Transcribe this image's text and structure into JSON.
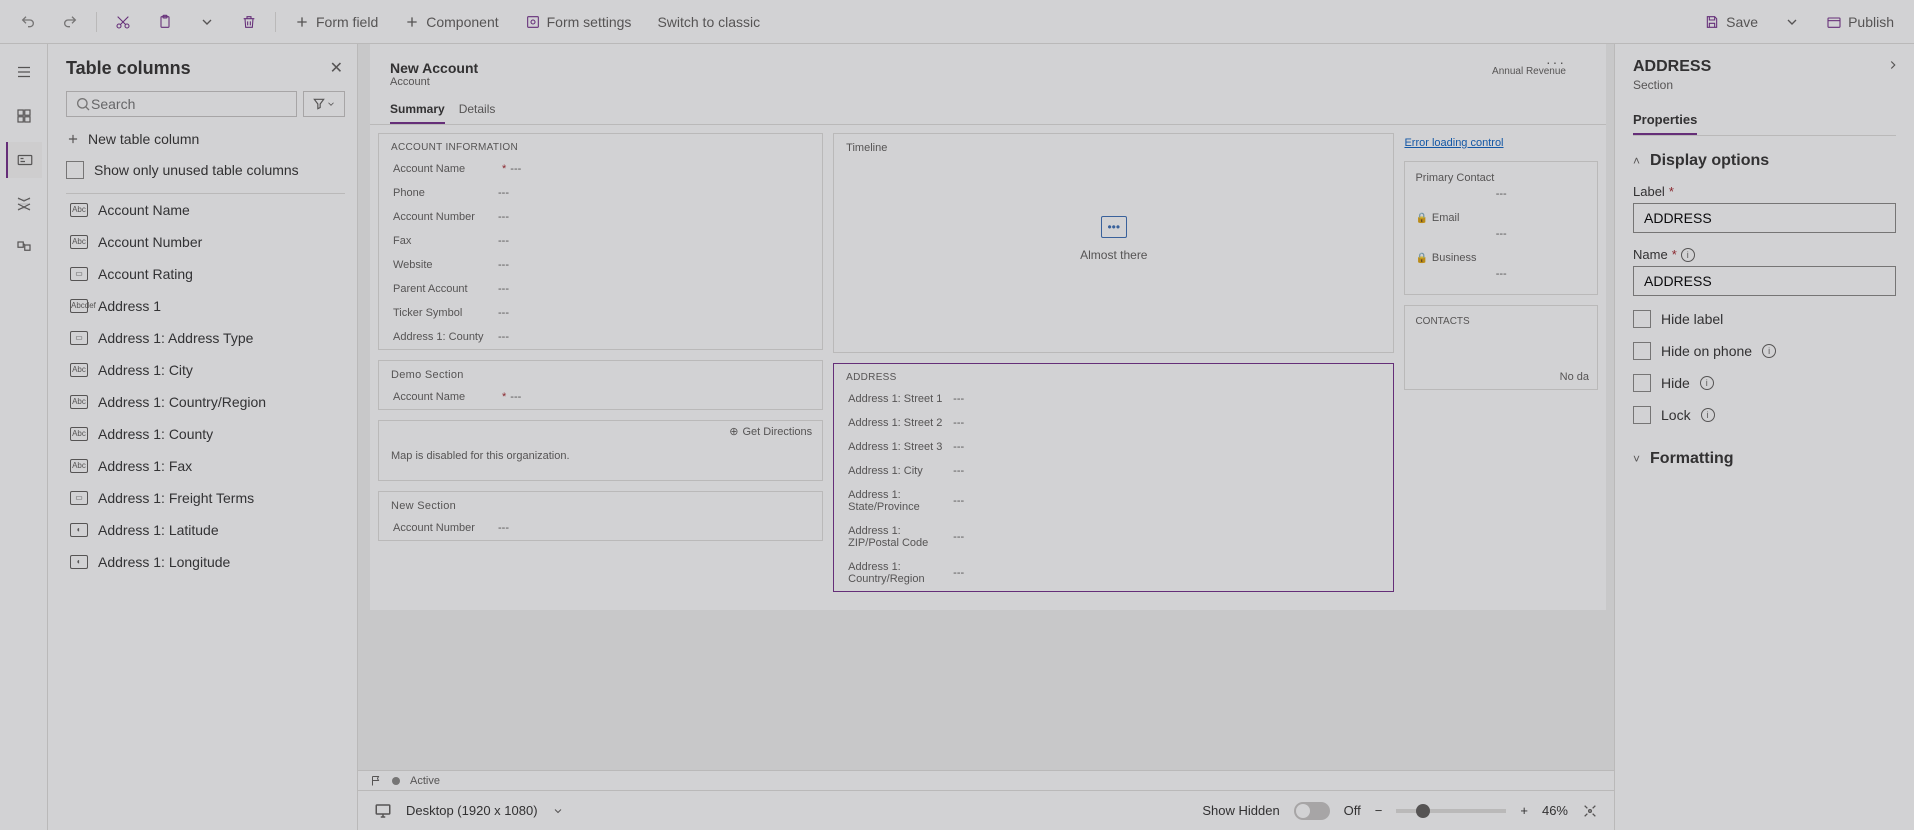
{
  "toolbar": {
    "form_field": "Form field",
    "component": "Component",
    "form_settings": "Form settings",
    "switch_classic": "Switch to classic",
    "save": "Save",
    "publish": "Publish"
  },
  "columns_panel": {
    "title": "Table columns",
    "search_placeholder": "Search",
    "new_column": "New table column",
    "show_unused": "Show only unused table columns",
    "items": [
      {
        "icon": "Abc",
        "label": "Account Name"
      },
      {
        "icon": "Abc",
        "label": "Account Number"
      },
      {
        "icon": "▭",
        "label": "Account Rating"
      },
      {
        "icon": "Abc\ndef",
        "label": "Address 1"
      },
      {
        "icon": "▭",
        "label": "Address 1: Address Type"
      },
      {
        "icon": "Abc",
        "label": "Address 1: City"
      },
      {
        "icon": "Abc",
        "label": "Address 1: Country/Region"
      },
      {
        "icon": "Abc",
        "label": "Address 1: County"
      },
      {
        "icon": "Abc",
        "label": "Address 1: Fax"
      },
      {
        "icon": "▭",
        "label": "Address 1: Freight Terms"
      },
      {
        "icon": "◐",
        "label": "Address 1: Latitude"
      },
      {
        "icon": "◐",
        "label": "Address 1: Longitude"
      }
    ]
  },
  "canvas": {
    "form_title": "New Account",
    "entity": "Account",
    "annual_rev": "Annual Revenue",
    "tabs": [
      "Summary",
      "Details"
    ],
    "active_tab": 0,
    "section_account_info": {
      "title": "ACCOUNT INFORMATION",
      "fields": [
        {
          "label": "Account Name",
          "required": true,
          "value": "---"
        },
        {
          "label": "Phone",
          "required": false,
          "value": "---"
        },
        {
          "label": "Account Number",
          "required": false,
          "value": "---"
        },
        {
          "label": "Fax",
          "required": false,
          "value": "---"
        },
        {
          "label": "Website",
          "required": false,
          "value": "---"
        },
        {
          "label": "Parent Account",
          "required": false,
          "value": "---"
        },
        {
          "label": "Ticker Symbol",
          "required": false,
          "value": "---"
        },
        {
          "label": "Address 1: County",
          "required": false,
          "value": "---"
        }
      ]
    },
    "section_demo": {
      "title": "Demo Section",
      "fields": [
        {
          "label": "Account Name",
          "required": true,
          "value": "---"
        }
      ]
    },
    "section_map": {
      "get_directions": "Get Directions",
      "message": "Map is disabled for this organization."
    },
    "section_new": {
      "title": "New Section",
      "fields": [
        {
          "label": "Account Number",
          "required": false,
          "value": "---"
        }
      ]
    },
    "section_timeline": {
      "title": "Timeline",
      "message": "Almost there"
    },
    "section_address": {
      "title": "ADDRESS",
      "fields": [
        {
          "label": "Address 1: Street 1",
          "value": "---"
        },
        {
          "label": "Address 1: Street 2",
          "value": "---"
        },
        {
          "label": "Address 1: Street 3",
          "value": "---"
        },
        {
          "label": "Address 1: City",
          "value": "---"
        },
        {
          "label": "Address 1: State/Province",
          "value": "---"
        },
        {
          "label": "Address 1: ZIP/Postal Code",
          "value": "---"
        },
        {
          "label": "Address 1: Country/Region",
          "value": "---"
        }
      ]
    },
    "side_col": {
      "error_link": "Error loading control",
      "primary_contact": "Primary Contact",
      "email": "Email",
      "business": "Business",
      "contacts": "CONTACTS",
      "nodata": "No da",
      "dashval": "---"
    },
    "status": {
      "label": "Active"
    }
  },
  "bottom": {
    "viewport": "Desktop (1920 x 1080)",
    "show_hidden": "Show Hidden",
    "toggle_state": "Off",
    "zoom": "46%"
  },
  "props": {
    "title": "ADDRESS",
    "subtitle": "Section",
    "tab": "Properties",
    "group_display": "Display options",
    "label_field": "Label",
    "label_value": "ADDRESS",
    "name_field": "Name",
    "name_value": "ADDRESS",
    "hide_label": "Hide label",
    "hide_phone": "Hide on phone",
    "hide": "Hide",
    "lock": "Lock",
    "group_formatting": "Formatting"
  }
}
